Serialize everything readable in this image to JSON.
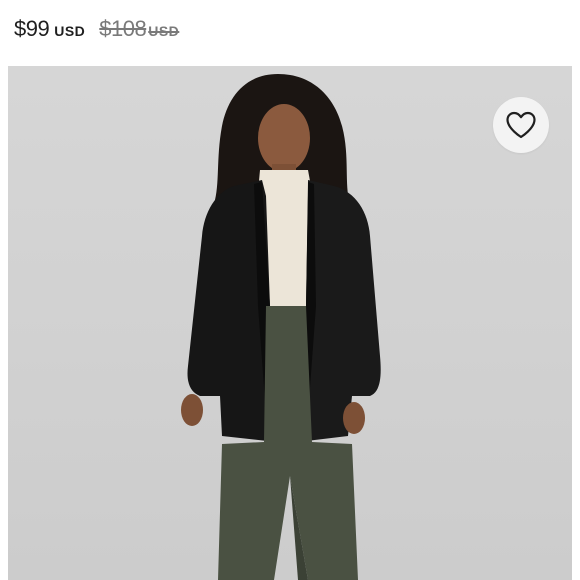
{
  "price": {
    "current_amount": "$99",
    "current_currency": "USD",
    "original_amount": "$108",
    "original_currency": "USD"
  },
  "product_image": {
    "icon": "heart-icon"
  },
  "colors": {
    "background": "#ffffff",
    "image_backdrop": "#d3d3d3",
    "jacket": "#161616",
    "top": "#ece5d8",
    "pants": "#4a5142",
    "price_text": "#1f1f1f",
    "strike_text": "#7a7a7a",
    "fav_button": "#f3f3f3"
  }
}
